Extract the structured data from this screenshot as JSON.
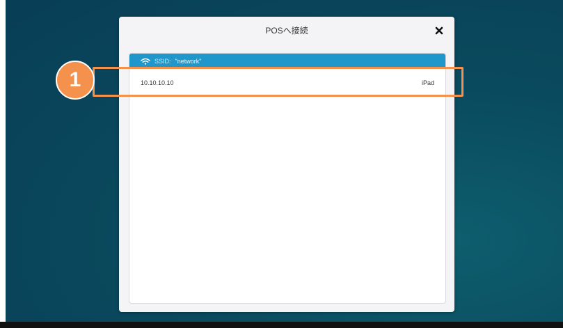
{
  "dialog": {
    "title": "POSへ接続",
    "close_icon": "close-icon"
  },
  "network": {
    "icon": "wifi-icon",
    "ssid_label": "SSID:",
    "ssid_value": "\"network\""
  },
  "devices": [
    {
      "ip": "10.10.10.10",
      "type": "iPad"
    }
  ],
  "annotation": {
    "step_number": "1"
  },
  "colors": {
    "network_header": "#1f97cb",
    "highlight": "#f4914c",
    "background": "#0a4a5e"
  }
}
